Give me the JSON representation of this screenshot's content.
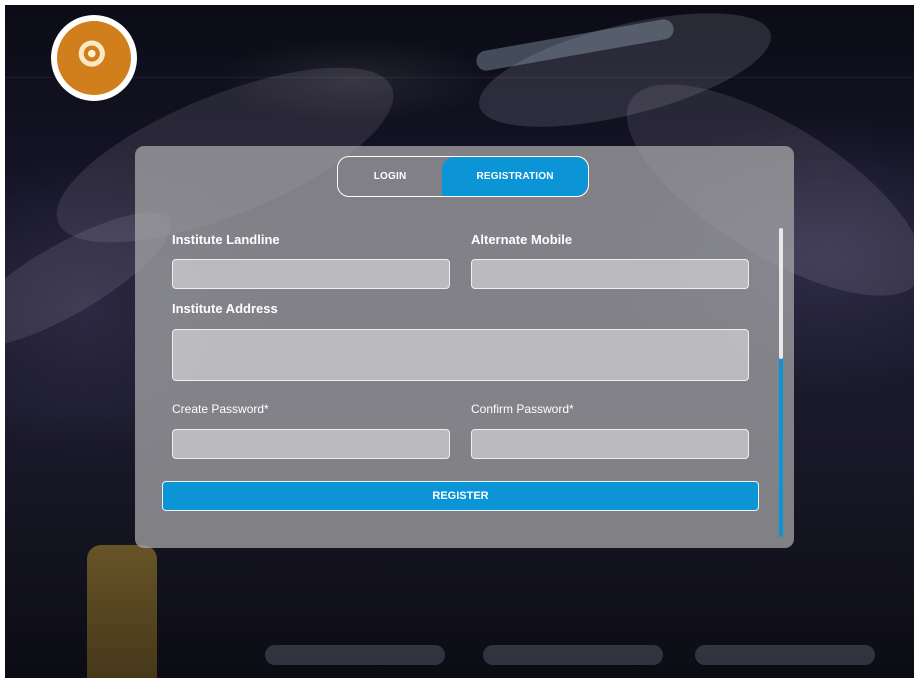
{
  "logo": {
    "name": "institute-emblem"
  },
  "tabs": [
    {
      "label": "LOGIN",
      "active": false
    },
    {
      "label": "REGISTRATION",
      "active": true
    }
  ],
  "form": {
    "institute_landline": {
      "label": "Institute Landline",
      "value": "",
      "placeholder": ""
    },
    "alternate_mobile": {
      "label": "Alternate Mobile",
      "value": "",
      "placeholder": ""
    },
    "institute_address": {
      "label": "Institute Address",
      "value": "",
      "placeholder": ""
    },
    "create_password": {
      "label": "Create Password*",
      "value": "",
      "placeholder": ""
    },
    "confirm_password": {
      "label": "Confirm Password*",
      "value": "",
      "placeholder": ""
    }
  },
  "register_label": "REGISTER",
  "colors": {
    "accent": "#0b95d6",
    "logo": "#d17e1c",
    "panel": "#aaaaac"
  }
}
